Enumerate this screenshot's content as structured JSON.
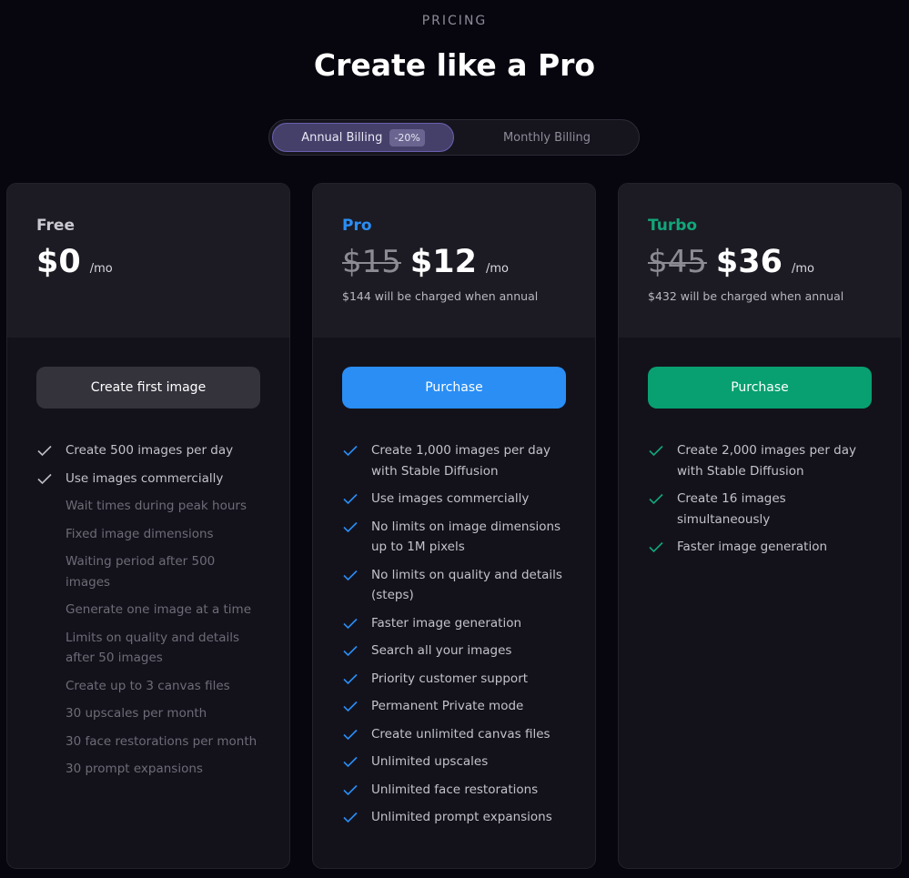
{
  "header": {
    "eyebrow": "PRICING",
    "title": "Create like a Pro"
  },
  "billing_toggle": {
    "annual_label": "Annual Billing",
    "annual_badge": "-20%",
    "monthly_label": "Monthly Billing",
    "selected": "annual"
  },
  "plans": [
    {
      "name": "Free",
      "name_color": "#c9c8cf",
      "old_price": "",
      "price": "$0",
      "period": "/mo",
      "note": "",
      "cta_label": "Create first image",
      "cta_color": "#34333c",
      "check_color": "#bcbbc4",
      "features": [
        {
          "text": "Create 500 images per day",
          "included": true
        },
        {
          "text": "Use images commercially",
          "included": true
        },
        {
          "text": "Wait times during peak hours",
          "included": false
        },
        {
          "text": "Fixed image dimensions",
          "included": false
        },
        {
          "text": "Waiting period after 500 images",
          "included": false
        },
        {
          "text": "Generate one image at a time",
          "included": false
        },
        {
          "text": "Limits on quality and details after 50 images",
          "included": false
        },
        {
          "text": "Create up to 3 canvas files",
          "included": false
        },
        {
          "text": "30 upscales per month",
          "included": false
        },
        {
          "text": "30 face restorations per month",
          "included": false
        },
        {
          "text": "30 prompt expansions",
          "included": false
        }
      ]
    },
    {
      "name": "Pro",
      "name_color": "#2a8ef5",
      "old_price": "$15",
      "price": "$12",
      "period": "/mo",
      "note": "$144 will be charged when annual",
      "cta_label": "Purchase",
      "cta_color": "#2a8ef5",
      "check_color": "#2a8ef5",
      "features": [
        {
          "text": "Create 1,000 images per day with Stable Diffusion",
          "included": true
        },
        {
          "text": "Use images commercially",
          "included": true
        },
        {
          "text": "No limits on image dimensions up to 1M pixels",
          "included": true
        },
        {
          "text": "No limits on quality and details (steps)",
          "included": true
        },
        {
          "text": "Faster image generation",
          "included": true
        },
        {
          "text": "Search all your images",
          "included": true
        },
        {
          "text": "Priority customer support",
          "included": true
        },
        {
          "text": "Permanent Private mode",
          "included": true
        },
        {
          "text": "Create unlimited canvas files",
          "included": true
        },
        {
          "text": "Unlimited upscales",
          "included": true
        },
        {
          "text": "Unlimited face restorations",
          "included": true
        },
        {
          "text": "Unlimited prompt expansions",
          "included": true
        }
      ]
    },
    {
      "name": "Turbo",
      "name_color": "#12a67a",
      "old_price": "$45",
      "price": "$36",
      "period": "/mo",
      "note": "$432 will be charged when annual",
      "cta_label": "Purchase",
      "cta_color": "#08a070",
      "check_color": "#12a67a",
      "features": [
        {
          "text": "Create 2,000 images per day with Stable Diffusion",
          "included": true
        },
        {
          "text": "Create 16 images simultaneously",
          "included": true
        },
        {
          "text": "Faster image generation",
          "included": true
        }
      ]
    }
  ]
}
